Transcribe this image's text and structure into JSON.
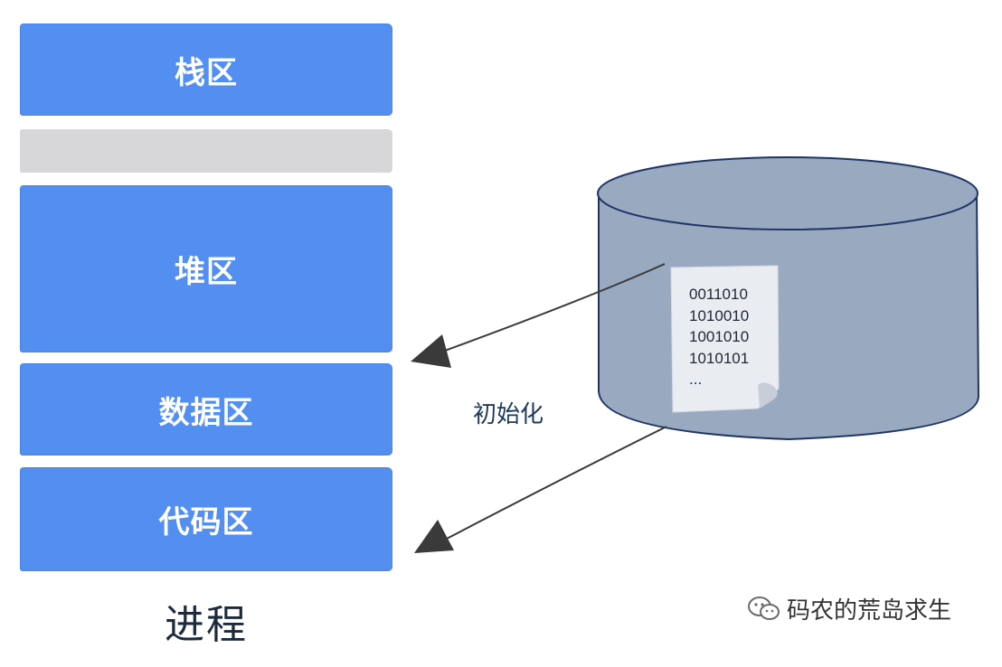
{
  "process": {
    "segments": [
      {
        "id": "stack",
        "label": "栈区"
      },
      {
        "id": "heap",
        "label": "堆区"
      },
      {
        "id": "data",
        "label": "数据区"
      },
      {
        "id": "code",
        "label": "代码区"
      }
    ],
    "caption": "进程"
  },
  "disk": {
    "document_lines": [
      "0011010",
      "1010010",
      "1001010",
      "1010101",
      "..."
    ]
  },
  "arrow_label": "初始化",
  "watermark": {
    "text": "码农的荒岛求生",
    "icon": "wechat-icon"
  },
  "colors": {
    "segment_blue": "#528ff0",
    "gap_gray": "#d7d7d9",
    "cylinder_fill": "#98a9c0",
    "cylinder_stroke": "#1f3566",
    "arrow": "#3a3a3a"
  }
}
